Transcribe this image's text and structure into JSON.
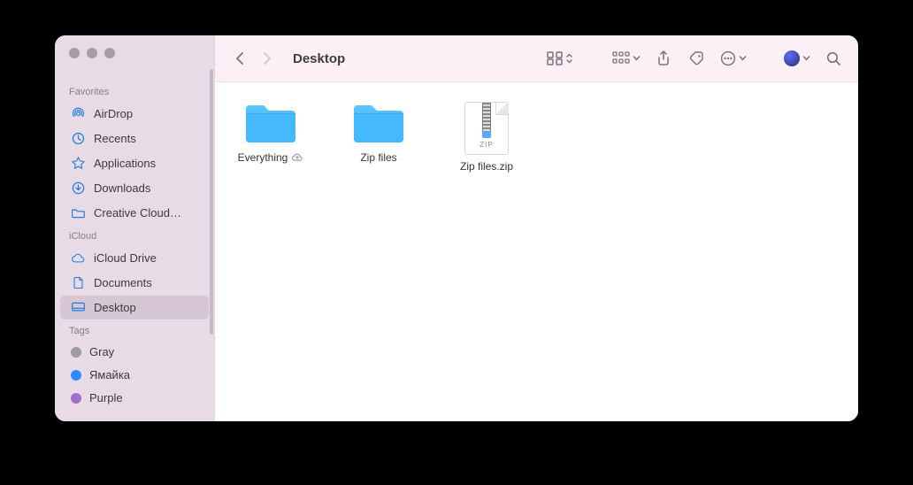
{
  "window": {
    "title": "Desktop"
  },
  "trafficColors": [
    "#a69ca3",
    "#a69ca3",
    "#a69ca3"
  ],
  "sidebar": {
    "sections": [
      {
        "title": "Favorites",
        "items": [
          {
            "id": "airdrop",
            "label": "AirDrop",
            "icon": "airdrop-icon"
          },
          {
            "id": "recents",
            "label": "Recents",
            "icon": "clock-icon"
          },
          {
            "id": "apps",
            "label": "Applications",
            "icon": "apps-icon"
          },
          {
            "id": "downloads",
            "label": "Downloads",
            "icon": "download-icon"
          },
          {
            "id": "ccloud",
            "label": "Creative Cloud…",
            "icon": "folder-icon"
          }
        ]
      },
      {
        "title": "iCloud",
        "items": [
          {
            "id": "icloud",
            "label": "iCloud Drive",
            "icon": "cloud-icon"
          },
          {
            "id": "docs",
            "label": "Documents",
            "icon": "document-icon"
          },
          {
            "id": "desktop",
            "label": "Desktop",
            "icon": "desktop-icon",
            "selected": true
          }
        ]
      },
      {
        "title": "Tags",
        "items": [
          {
            "id": "tag-gray",
            "label": "Gray",
            "color": "#9c9c9c"
          },
          {
            "id": "tag-blue",
            "label": "Ямайка",
            "color": "#2f8cff"
          },
          {
            "id": "tag-purple",
            "label": "Purple",
            "color": "#a06fcb"
          }
        ]
      }
    ]
  },
  "items": [
    {
      "name": "Everything",
      "kind": "folder",
      "cloud": true
    },
    {
      "name": "Zip files",
      "kind": "folder"
    },
    {
      "name": "Zip files.zip",
      "kind": "zip",
      "badge": "ZIP"
    }
  ]
}
